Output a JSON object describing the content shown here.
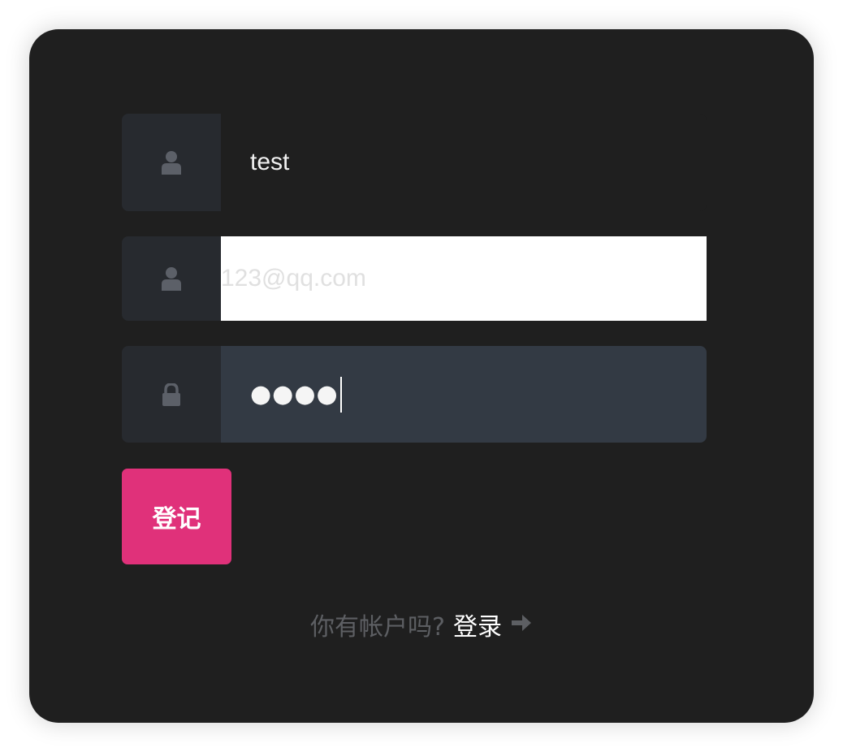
{
  "form": {
    "username": {
      "value": "test"
    },
    "email": {
      "placeholder": "123@qq.com"
    },
    "password": {
      "masked_value": "●●●●"
    },
    "submit_label": "登记"
  },
  "footer": {
    "question": "你有帐户吗?",
    "login_label": "登录"
  },
  "icons": {
    "username": "user-icon",
    "email": "user-icon",
    "password": "lock-icon",
    "login_arrow": "arrow-right-icon"
  },
  "colors": {
    "card_bg": "#1f1f1f",
    "icon_box_bg": "#272a2f",
    "password_bg": "#333a44",
    "accent": "#e0317a",
    "muted_text": "#5d5f63"
  }
}
